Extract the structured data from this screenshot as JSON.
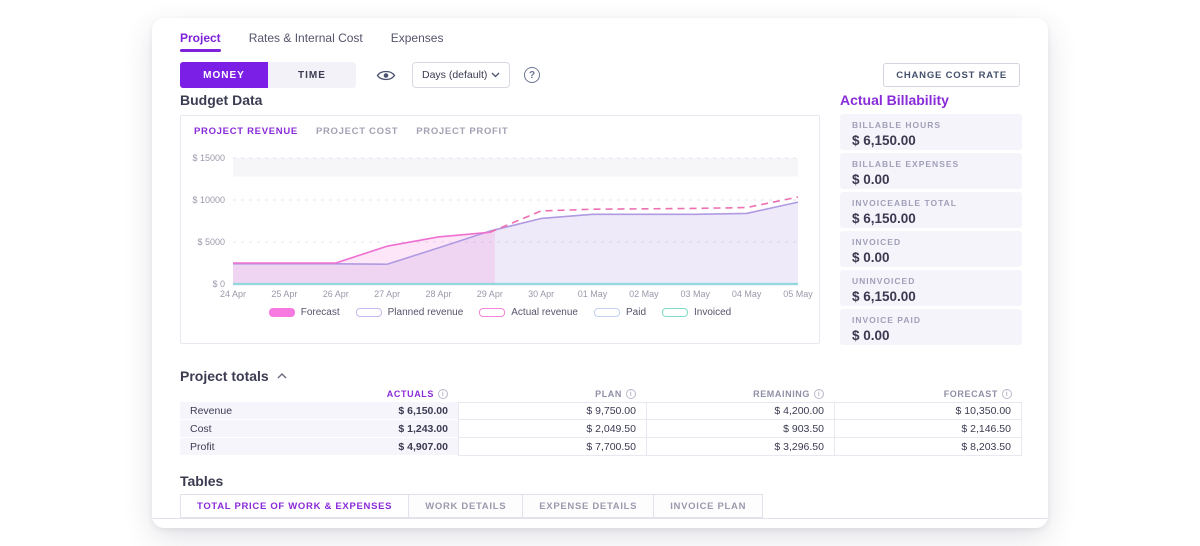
{
  "accent": "#7b1fe6",
  "nav_tabs": [
    {
      "label": "Project"
    },
    {
      "label": "Rates & Internal Cost"
    },
    {
      "label": "Expenses"
    }
  ],
  "controls": {
    "money_label": "MONEY",
    "time_label": "TIME",
    "period_dropdown_value": "Days (default)",
    "change_cost_rate_label": "CHANGE COST RATE"
  },
  "budget_section": {
    "title": "Budget Data",
    "chart_tabs": [
      {
        "label": "PROJECT REVENUE"
      },
      {
        "label": "PROJECT COST"
      },
      {
        "label": "PROJECT PROFIT"
      }
    ]
  },
  "chart_data": {
    "type": "line",
    "title": "Project revenue budget over time",
    "x": [
      "24 Apr",
      "25 Apr",
      "26 Apr",
      "27 Apr",
      "28 Apr",
      "29 Apr",
      "30 Apr",
      "01 May",
      "02 May",
      "03 May",
      "04 May",
      "05 May"
    ],
    "ylim": [
      0,
      15000
    ],
    "grid": true,
    "today_x": 5.1,
    "y_ticks": [
      {
        "label": "$ 0",
        "value": 0
      },
      {
        "label": "$ 5000",
        "value": 5000
      },
      {
        "label": "$ 10000",
        "value": 10000
      },
      {
        "label": "$ 15000",
        "value": 15000
      }
    ],
    "series": [
      {
        "name": "Planned revenue",
        "style": "solid",
        "color": "#b09ae2",
        "fill": "rgba(176,152,226,0.20)",
        "values": [
          2400,
          2400,
          2400,
          2350,
          4300,
          6300,
          7800,
          8300,
          8300,
          8300,
          8400,
          9750
        ]
      },
      {
        "name": "Actual revenue",
        "style": "solid",
        "color": "#ef6fd2",
        "fill": "rgba(242,128,216,0.20)",
        "area_extend": {
          "x": 5.1,
          "value": 6400
        },
        "values": [
          2500,
          2500,
          2500,
          4500,
          5600,
          6150,
          null,
          null,
          null,
          null,
          null,
          null
        ]
      },
      {
        "name": "Forecast",
        "style": "dashed",
        "color": "#ee6fb2",
        "values": [
          null,
          null,
          null,
          null,
          null,
          6150,
          8700,
          8900,
          8950,
          9000,
          9100,
          10350
        ]
      },
      {
        "name": "Paid",
        "style": "solid",
        "color": "#bdd0f2",
        "width": 2.4,
        "values": [
          0,
          0,
          0,
          0,
          0,
          0,
          0,
          0,
          0,
          0,
          0,
          0
        ]
      },
      {
        "name": "Invoiced",
        "style": "solid",
        "color": "#85dbd2",
        "width": 1.4,
        "values": [
          0,
          0,
          0,
          0,
          0,
          0,
          0,
          0,
          0,
          0,
          0,
          0
        ]
      }
    ],
    "legend": [
      {
        "label": "Forecast",
        "swatch": "filled",
        "color": "#f87ae0"
      },
      {
        "label": "Planned revenue",
        "swatch": "outline",
        "color": "#c9b8ec"
      },
      {
        "label": "Actual revenue",
        "swatch": "outline",
        "color": "#f584d8"
      },
      {
        "label": "Paid",
        "swatch": "outline",
        "color": "#c3d2f0"
      },
      {
        "label": "Invoiced",
        "swatch": "outline",
        "color": "#7fdcc8"
      }
    ],
    "legend_position": "bottom"
  },
  "billability": {
    "title": "Actual Billability",
    "cards": [
      {
        "label": "BILLABLE HOURS",
        "value": "$ 6,150.00"
      },
      {
        "label": "BILLABLE EXPENSES",
        "value": "$ 0.00"
      },
      {
        "label": "INVOICEABLE TOTAL",
        "value": "$ 6,150.00"
      },
      {
        "label": "INVOICED",
        "value": "$ 0.00"
      },
      {
        "label": "UNINVOICED",
        "value": "$ 6,150.00"
      },
      {
        "label": "INVOICE PAID",
        "value": "$ 0.00"
      }
    ]
  },
  "project_totals": {
    "title": "Project totals",
    "columns": [
      "ACTUALS",
      "PLAN",
      "REMAINING",
      "FORECAST"
    ],
    "rows": [
      {
        "label": "Revenue",
        "actuals": "$ 6,150.00",
        "plan": "$ 9,750.00",
        "remaining": "$ 4,200.00",
        "forecast": "$ 10,350.00"
      },
      {
        "label": "Cost",
        "actuals": "$ 1,243.00",
        "plan": "$ 2,049.50",
        "remaining": "$ 903.50",
        "forecast": "$ 2,146.50"
      },
      {
        "label": "Profit",
        "actuals": "$ 4,907.00",
        "plan": "$ 7,700.50",
        "remaining": "$ 3,296.50",
        "forecast": "$ 8,203.50"
      }
    ]
  },
  "tables_section": {
    "title": "Tables",
    "tabs": [
      {
        "label": "TOTAL PRICE OF WORK & EXPENSES"
      },
      {
        "label": "WORK DETAILS"
      },
      {
        "label": "EXPENSE DETAILS"
      },
      {
        "label": "INVOICE PLAN"
      }
    ]
  }
}
